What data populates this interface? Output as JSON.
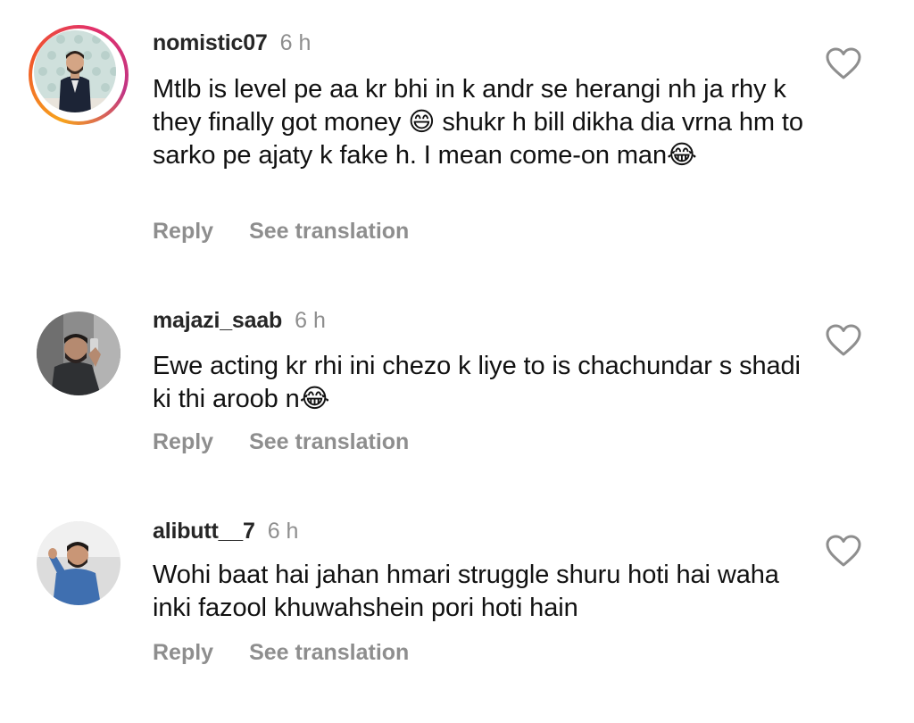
{
  "comments": [
    {
      "username": "nomistic07",
      "time": "6 h",
      "text": "Mtlb is level pe aa kr bhi in k andr se herangi nh ja rhy k they finally got money 😄 shukr h bill dikha dia vrna hm to sarko pe ajaty k fake h. I mean come-on man😂",
      "reply_label": "Reply",
      "translate_label": "See translation",
      "has_story": true
    },
    {
      "username": "majazi_saab",
      "time": "6 h",
      "text": "Ewe acting kr rhi ini chezo k liye to is chachundar s shadi ki thi aroob n😂",
      "reply_label": "Reply",
      "translate_label": "See translation",
      "has_story": false
    },
    {
      "username": "alibutt__7",
      "time": "6 h",
      "text": "Wohi baat hai jahan hmari struggle shuru hoti hai waha inki fazool khuwahshein pori hoti hain",
      "reply_label": "Reply",
      "translate_label": "See translation",
      "has_story": false
    }
  ],
  "icons": {
    "like": "heart-outline-icon"
  },
  "colors": {
    "username": "#262626",
    "secondary": "#8e8e8e",
    "story_ring": [
      "#f7a31c",
      "#f0562b",
      "#e1306c",
      "#c13584"
    ]
  }
}
